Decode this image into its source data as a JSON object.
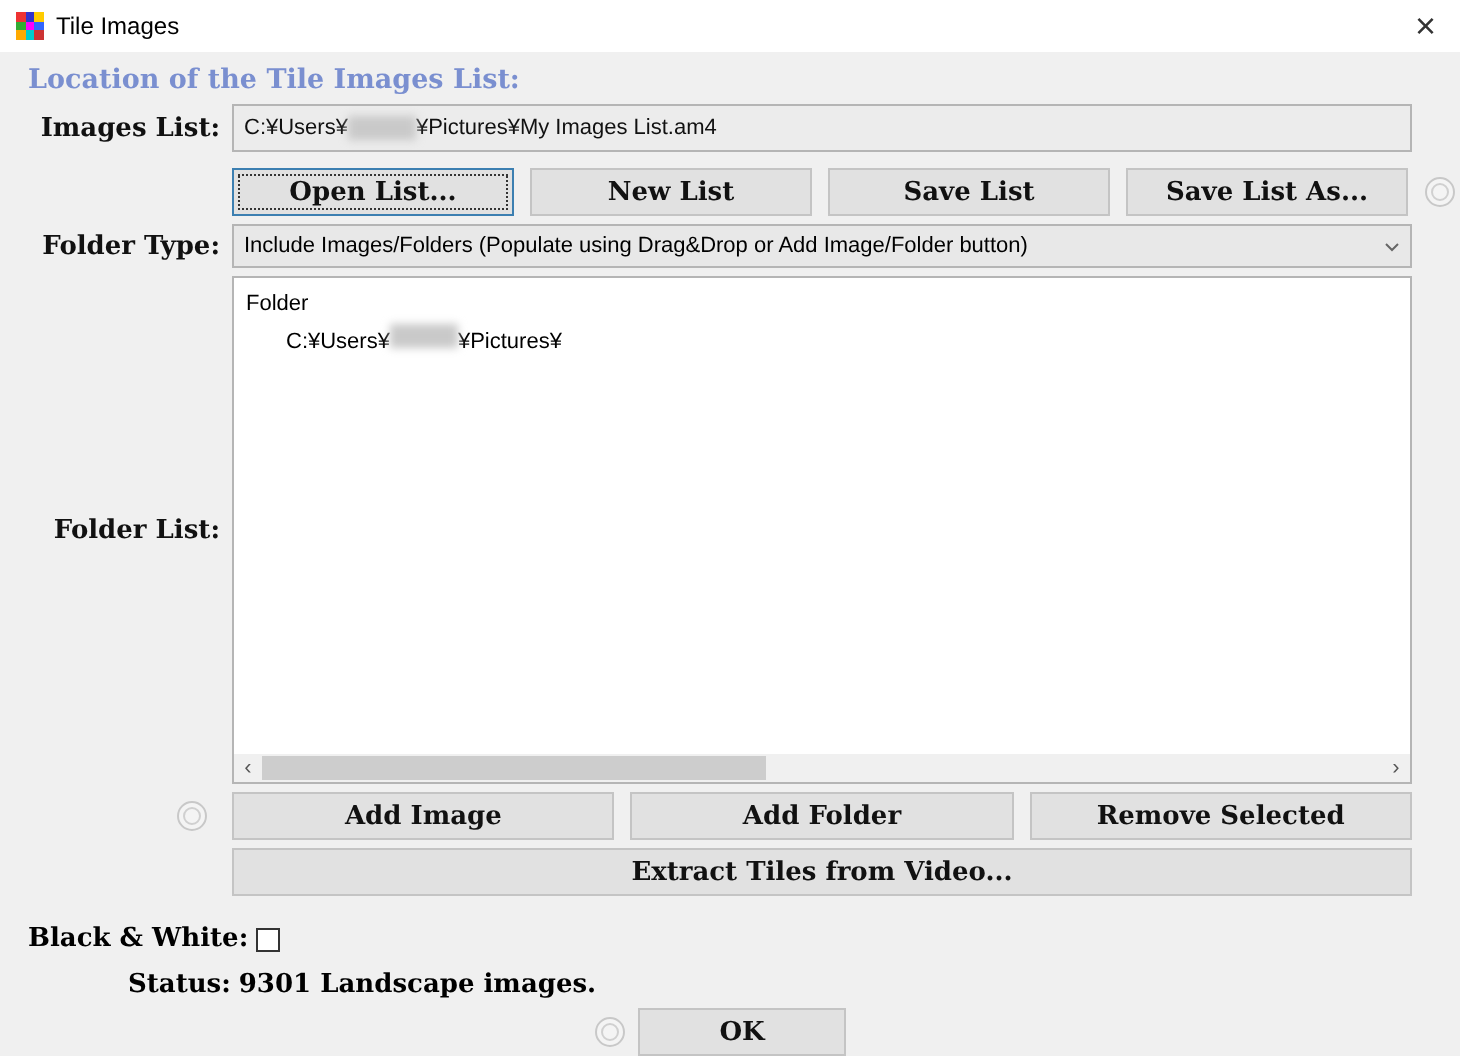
{
  "window": {
    "title": "Tile Images",
    "close": "×"
  },
  "section_title": "Location of the Tile Images List:",
  "images_list": {
    "label": "Images List:",
    "path_start": "C:¥Users¥",
    "path_end": "¥Pictures¥My Images List.am4"
  },
  "list_buttons": [
    {
      "label": "Open List...",
      "focused": true
    },
    {
      "label": "New List",
      "focused": false
    },
    {
      "label": "Save List",
      "focused": false
    },
    {
      "label": "Save List As...",
      "focused": false
    }
  ],
  "folder_type": {
    "label": "Folder Type:",
    "value": "Include Images/Folders (Populate using Drag&Drop or Add Image/Folder button)"
  },
  "folder_list": {
    "label": "Folder List:",
    "items": [
      {
        "text": "Folder",
        "children": [
          {
            "text_start": "C:¥Users¥",
            "text_end": "¥Pictures¥"
          }
        ]
      }
    ],
    "scroll_left": "‹",
    "scroll_right": "›"
  },
  "folder_buttons": [
    "Add Image",
    "Add Folder",
    "Remove Selected"
  ],
  "extract_button": "Extract Tiles from Video...",
  "black_white": {
    "label": "Black & White:",
    "checked": false
  },
  "status": {
    "label": "Status:",
    "value": "9301 Landscape images."
  },
  "ok_button": "OK"
}
